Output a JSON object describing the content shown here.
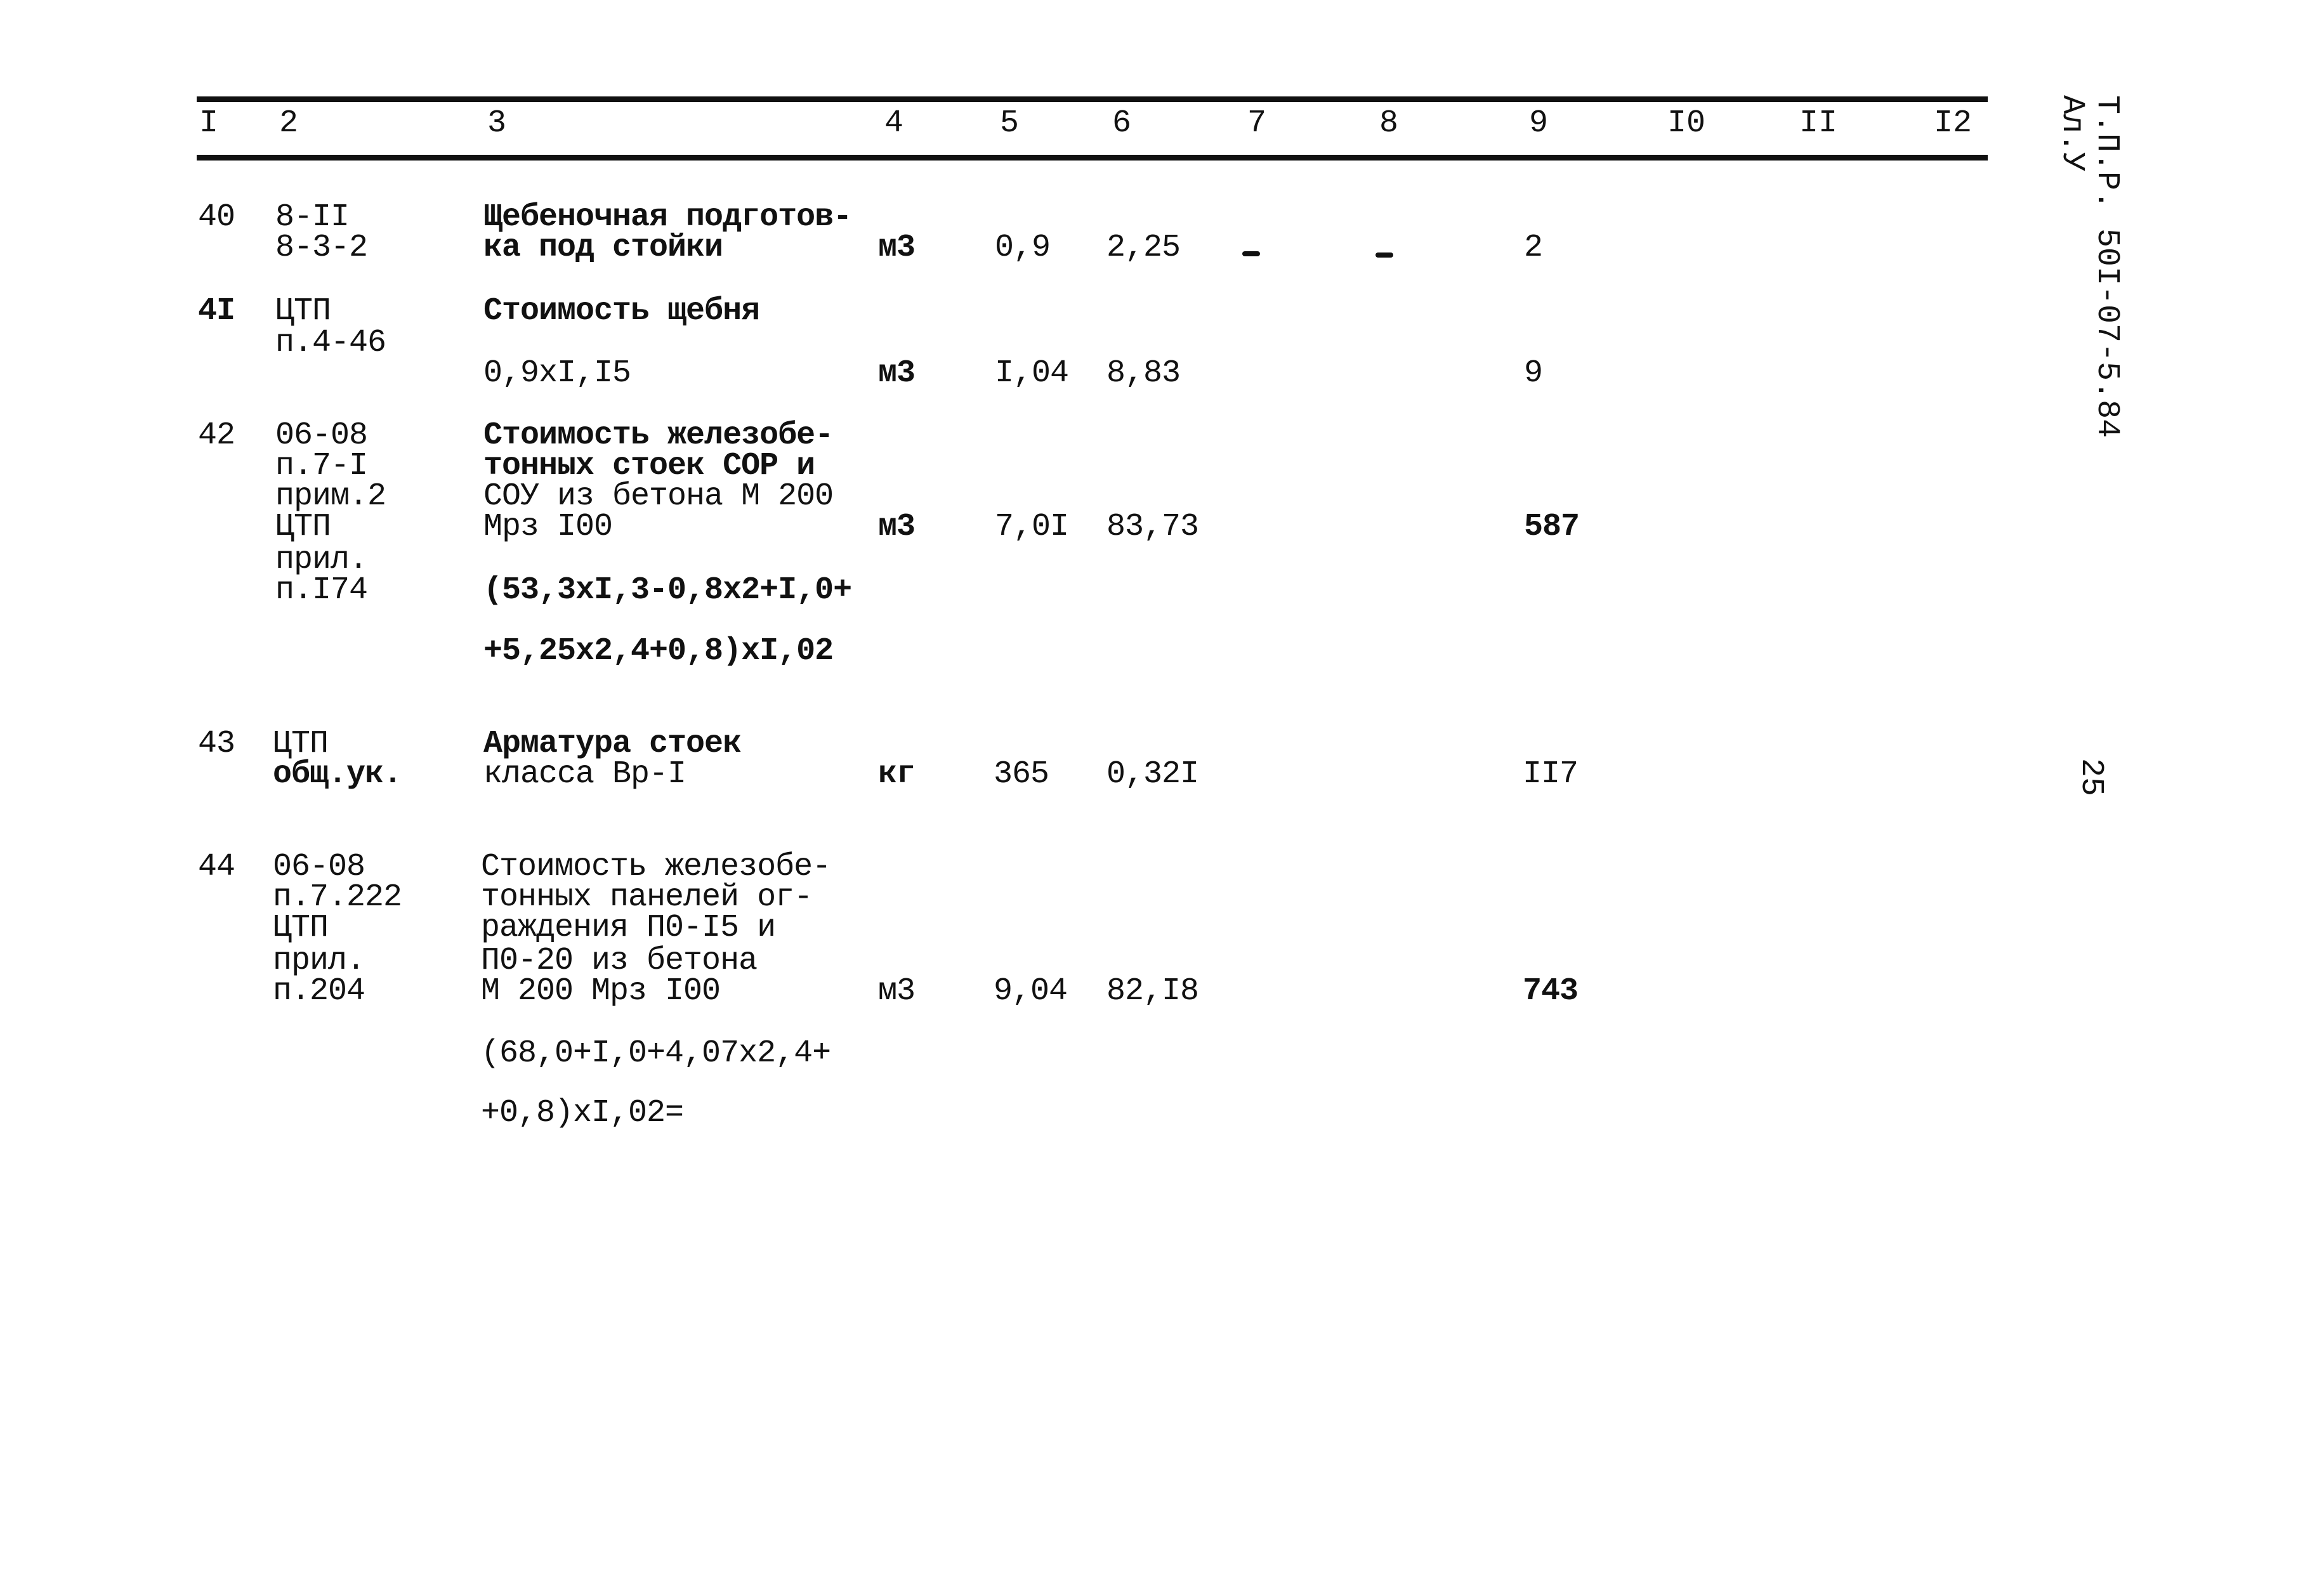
{
  "header": {
    "columns": [
      "I",
      "2",
      "3",
      "4",
      "5",
      "6",
      "7",
      "8",
      "9",
      "I0",
      "II",
      "I2"
    ]
  },
  "side": {
    "doc_code": "Т.П.Р. 50I-07-5.84",
    "album": "Ал.У",
    "page_number": "25"
  },
  "rows": [
    {
      "num": "40",
      "code": [
        "8-II",
        "8-3-2"
      ],
      "description": [
        "Щебеночная подготов-",
        "ка под стойки"
      ],
      "formula": [],
      "unit": "м3",
      "quantity": "0,9",
      "price": "2,25",
      "col7": "-",
      "col8": "-",
      "total": "2"
    },
    {
      "num": "4I",
      "code": [
        "ЦТП",
        "п.4-46"
      ],
      "description": [
        "Стоимость щебня"
      ],
      "formula": [
        "0,9xI,I5"
      ],
      "unit": "м3",
      "quantity": "I,04",
      "price": "8,83",
      "total": "9"
    },
    {
      "num": "42",
      "code": [
        "06-08",
        "п.7-I",
        "прим.2",
        "ЦТП",
        "прил.",
        "п.I74"
      ],
      "description": [
        "Стоимость железобе-",
        "тонных стоек СОР и",
        "СОУ из бетона М 200",
        "Мрз I00"
      ],
      "formula": [
        "(53,3xI,3-0,8x2+I,0+",
        "+5,25x2,4+0,8)xI,02"
      ],
      "unit": "м3",
      "quantity": "7,0I",
      "price": "83,73",
      "total": "587"
    },
    {
      "num": "43",
      "code": [
        "ЦТП",
        "общ.ук."
      ],
      "description": [
        "Арматура стоек",
        "класса Вр-I"
      ],
      "formula": [],
      "unit": "кг",
      "quantity": "365",
      "price": "0,32I",
      "total": "II7"
    },
    {
      "num": "44",
      "code": [
        "06-08",
        "п.7.222",
        "ЦТП",
        "прил.",
        "п.204"
      ],
      "description": [
        "Стоимость железобе-",
        "тонных панелей ог-",
        "раждения П0-I5 и",
        "П0-20 из бетона",
        "М 200 Мрз I00"
      ],
      "formula": [
        "(68,0+I,0+4,07x2,4+",
        "+0,8)xI,02="
      ],
      "unit": "м3",
      "quantity": "9,04",
      "price": "82,I8",
      "total": "743"
    }
  ]
}
